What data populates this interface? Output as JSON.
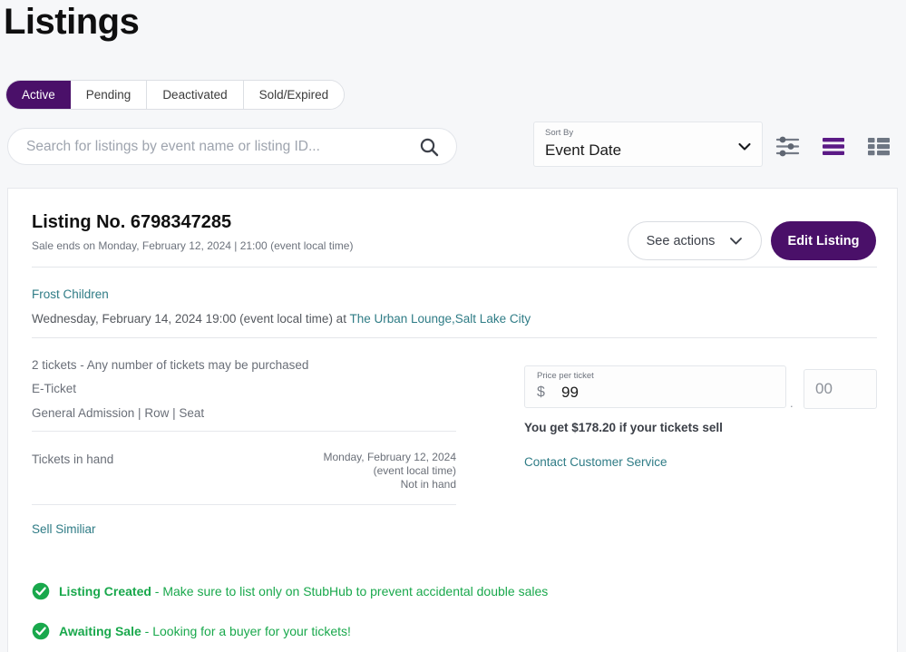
{
  "header": {
    "title": "Listings"
  },
  "tabs": [
    {
      "label": "Active",
      "active": true
    },
    {
      "label": "Pending",
      "active": false
    },
    {
      "label": "Deactivated",
      "active": false
    },
    {
      "label": "Sold/Expired",
      "active": false
    }
  ],
  "search": {
    "placeholder": "Search for listings by event name or listing ID...",
    "value": ""
  },
  "sort": {
    "label": "Sort By",
    "value": "Event Date",
    "options": [
      "Event Date"
    ]
  },
  "toolbar": {
    "filter_icon": "sliders-icon",
    "list_view_icon": "list-view-icon",
    "grid_view_icon": "grid-view-icon",
    "active_view": "list"
  },
  "listing": {
    "number_label": "Listing No. 6798347285",
    "sale_ends": "Sale ends on Monday, February 12, 2024 | 21:00 (event local time)",
    "see_actions_label": "See actions",
    "edit_listing_label": "Edit Listing",
    "performer": "Frost Children",
    "event_datetime": "Wednesday, February 14, 2024 19:00 (event local time) at ",
    "venue": "The Urban Lounge,",
    "city": "Salt Lake City",
    "ticket_quantity": "2 tickets - Any number of tickets may be purchased",
    "delivery_type": "E-Ticket",
    "seating": "General Admission | Row | Seat",
    "tickets_in_hand_label": "Tickets in hand",
    "tickets_in_hand_date": "Monday, February 12, 2024",
    "tickets_in_hand_tz": "(event local time)",
    "tickets_in_hand_status": "Not in hand",
    "sell_similar_label": "Sell Similiar"
  },
  "price": {
    "label": "Price per ticket",
    "currency_symbol": "$",
    "dollars": "99",
    "separator": ".",
    "cents": "00",
    "payout_text": "You get $178.20 if your tickets sell",
    "contact_label": "Contact Customer Service"
  },
  "statuses": [
    {
      "title": "Listing Created",
      "detail": " - Make sure to list only on StubHub to prevent accidental double sales",
      "icon": "check-circle-icon"
    },
    {
      "title": "Awaiting Sale",
      "detail": " - Looking for a buyer for your tickets!",
      "icon": "check-circle-icon"
    }
  ],
  "colors": {
    "brand_purple": "#4a1069",
    "link_teal": "#2f7c86",
    "success_green": "#19a84c",
    "page_bg": "#f6f7f9"
  }
}
